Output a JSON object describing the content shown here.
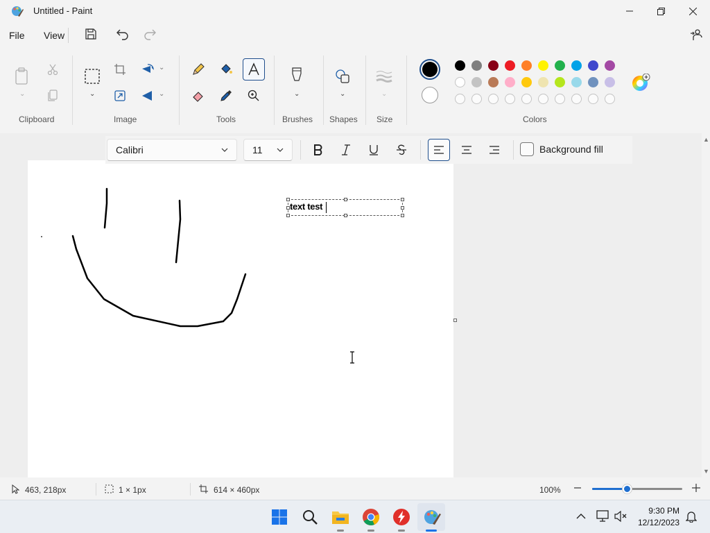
{
  "window": {
    "title": "Untitled - Paint"
  },
  "menu": {
    "file": "File",
    "view": "View"
  },
  "ribbon": {
    "groups": {
      "clipboard": "Clipboard",
      "image": "Image",
      "tools": "Tools",
      "brushes": "Brushes",
      "shapes": "Shapes",
      "size": "Size",
      "colors": "Colors"
    },
    "primary_color": "#000000",
    "secondary_color": "#ffffff",
    "palette_row1": [
      "#000000",
      "#7f7f7f",
      "#880015",
      "#ed1c24",
      "#ff7f27",
      "#fff200",
      "#22b14c",
      "#00a2e8",
      "#3f48cc",
      "#a349a4"
    ],
    "palette_row2": [
      "#ffffff",
      "#c3c3c3",
      "#b97a57",
      "#ffaec9",
      "#ffc90e",
      "#efe4b0",
      "#b5e61d",
      "#99d9ea",
      "#7092be",
      "#c8bfe7"
    ]
  },
  "textbar": {
    "font": "Calibri",
    "size": "11",
    "background_fill": "Background fill"
  },
  "canvas": {
    "text": "text test"
  },
  "status": {
    "cursor": "463, 218px",
    "selection": "1 × 1px",
    "canvas_size": "614 × 460px",
    "zoom": "100%"
  },
  "taskbar": {
    "time": "9:30 PM",
    "date": "12/12/2023"
  }
}
